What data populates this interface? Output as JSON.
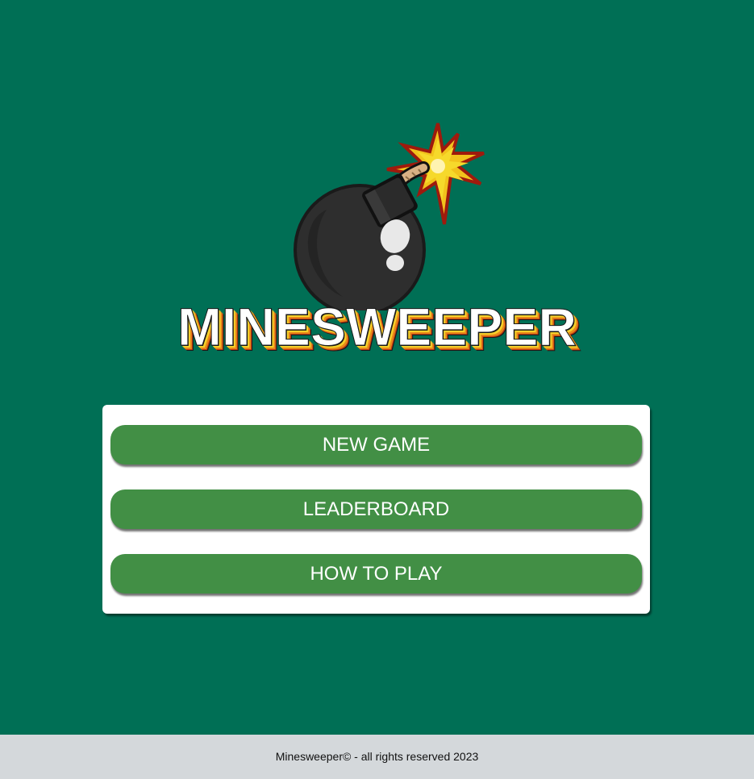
{
  "app": {
    "title": "MINESWEEPER",
    "logo_icon": "bomb-icon"
  },
  "menu": {
    "items": [
      {
        "label": "NEW GAME"
      },
      {
        "label": "LEADERBOARD"
      },
      {
        "label": "HOW TO PLAY"
      }
    ]
  },
  "footer": {
    "text": "Minesweeper© - all rights reserved 2023"
  },
  "colors": {
    "background": "#006f55",
    "button": "#428f45",
    "card": "#ffffff",
    "footer": "#d4d8db"
  }
}
